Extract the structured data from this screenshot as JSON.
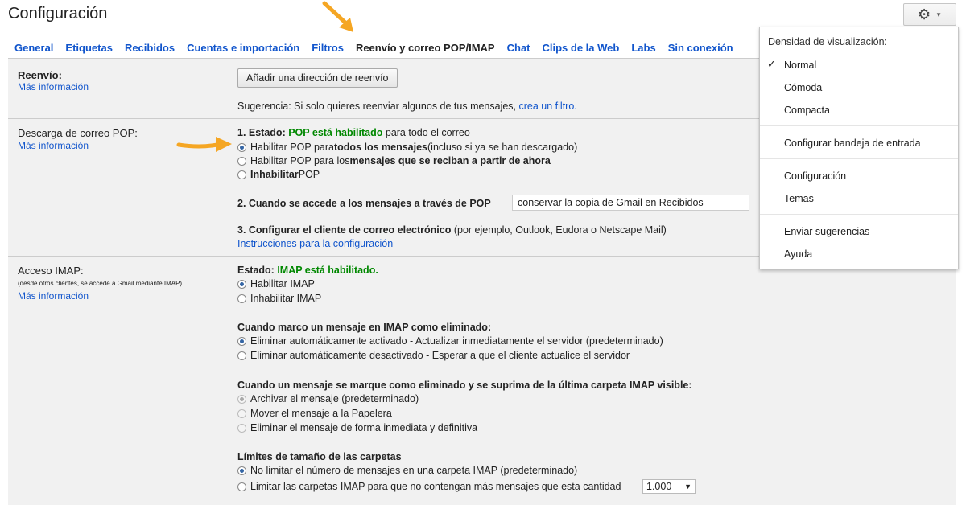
{
  "header": {
    "title": "Configuración",
    "gear_icon": "gear-icon"
  },
  "tabs": [
    {
      "label": "General",
      "active": false
    },
    {
      "label": "Etiquetas",
      "active": false
    },
    {
      "label": "Recibidos",
      "active": false
    },
    {
      "label": "Cuentas e importación",
      "active": false
    },
    {
      "label": "Filtros",
      "active": false
    },
    {
      "label": "Reenvío y correo POP/IMAP",
      "active": true
    },
    {
      "label": "Chat",
      "active": false
    },
    {
      "label": "Clips de la Web",
      "active": false
    },
    {
      "label": "Labs",
      "active": false
    },
    {
      "label": "Sin conexión",
      "active": false
    }
  ],
  "forwarding": {
    "label": "Reenvío:",
    "more": "Más información",
    "add_button": "Añadir una dirección de reenvío",
    "tip_prefix": "Sugerencia: Si solo quieres reenviar algunos de tus mensajes, ",
    "tip_link": "crea un filtro."
  },
  "pop": {
    "label": "Descarga de correo POP:",
    "more": "Más información",
    "status_prefix": "1. Estado: ",
    "status_value": "POP está habilitado",
    "status_suffix": " para todo el correo",
    "options": [
      {
        "pre": "Habilitar POP para ",
        "bold": "todos los mensajes",
        "post": " (incluso si ya se han descargado)",
        "checked": true
      },
      {
        "pre": "Habilitar POP para los ",
        "bold": "mensajes que se reciban a partir de ahora",
        "post": "",
        "checked": false
      },
      {
        "pre": "",
        "bold": "Inhabilitar",
        "post": " POP",
        "checked": false
      }
    ],
    "access_label": "2. Cuando se accede a los mensajes a través de POP",
    "access_value": "conservar la copia de Gmail en Recibidos",
    "client_bold": "3. Configurar el cliente de correo electrónico",
    "client_rest": " (por ejemplo, Outlook, Eudora o Netscape Mail)",
    "client_link": "Instrucciones para la configuración"
  },
  "imap": {
    "label": "Acceso IMAP:",
    "note": "(desde otros clientes, se accede a Gmail mediante IMAP)",
    "more": "Más información",
    "status_prefix": "Estado: ",
    "status_value": "IMAP está habilitado.",
    "enable": "Habilitar IMAP",
    "disable": "Inhabilitar IMAP",
    "deleted_heading": "Cuando marco un mensaje en IMAP como eliminado:",
    "deleted_opt1": "Eliminar automáticamente activado - Actualizar inmediatamente el servidor (predeterminado)",
    "deleted_opt2": "Eliminar automáticamente desactivado - Esperar a que el cliente actualice el servidor",
    "expunge_heading": "Cuando un mensaje se marque como eliminado y se suprima de la última carpeta IMAP visible:",
    "expunge_opt1": "Archivar el mensaje (predeterminado)",
    "expunge_opt2": "Mover el mensaje a la Papelera",
    "expunge_opt3": "Eliminar el mensaje de forma inmediata y definitiva",
    "limits_heading": "Límites de tamaño de las carpetas",
    "limits_opt1": "No limitar el número de mensajes en una carpeta IMAP (predeterminado)",
    "limits_opt2": "Limitar las carpetas IMAP para que no contengan más mensajes que esta cantidad",
    "limits_value": "1.000"
  },
  "menu": {
    "heading": "Densidad de visualización:",
    "density": [
      "Normal",
      "Cómoda",
      "Compacta"
    ],
    "checked": "Normal",
    "configure_inbox": "Configurar bandeja de entrada",
    "settings": "Configuración",
    "themes": "Temas",
    "feedback": "Enviar sugerencias",
    "help": "Ayuda"
  },
  "colors": {
    "link": "#1155cc",
    "status_green": "#008800",
    "arrow": "#f5a623"
  }
}
